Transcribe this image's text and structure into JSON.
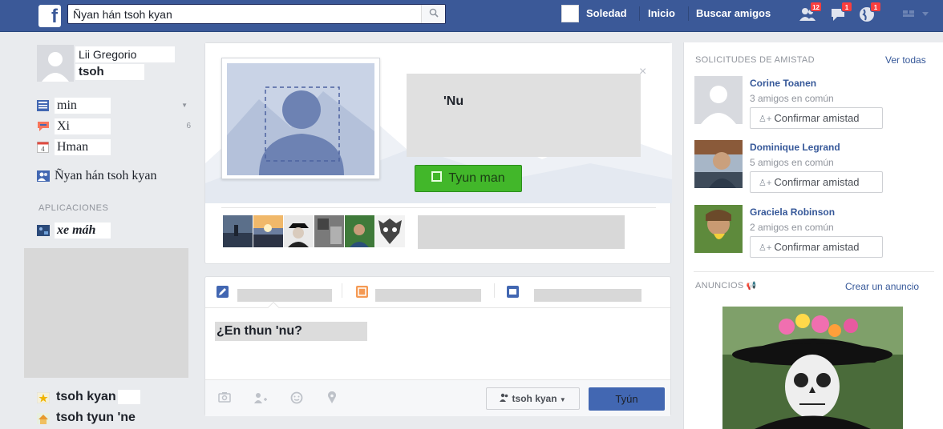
{
  "topbar": {
    "logo": "f",
    "search_value": "Ñyan hán tsoh kyan",
    "search_icon": "search-icon",
    "user_name": "Soledad",
    "home": "Inicio",
    "find_friends": "Buscar amigos",
    "friend_requests_badge": "12",
    "messages_badge": "1",
    "notifications_badge": "1"
  },
  "left": {
    "name_first": "Lii Gregorio",
    "name_second": "tsoh",
    "items": [
      {
        "label": "min",
        "icon": "news-feed-icon"
      },
      {
        "label": "Xi",
        "icon": "messages-icon",
        "count": "6"
      },
      {
        "label": "Hman",
        "icon": "events-icon",
        "date": "4"
      },
      {
        "label": "Ñyan hán tsoh kyan",
        "icon": "find-friends-icon"
      }
    ],
    "apps_label": "APLICACIONES",
    "app_item": "xe máh",
    "bottom_items": [
      {
        "label": "tsoh kyan",
        "icon": "star-icon"
      },
      {
        "label": "tsoh tyun 'ne",
        "icon": "house-icon"
      }
    ]
  },
  "hero": {
    "text": "'Nu",
    "button_label": "Tyun man",
    "close": "×"
  },
  "composer": {
    "placeholder": "¿En thun 'nu?",
    "audience": "tsoh kyan",
    "post_label": "Tyún"
  },
  "right": {
    "requests_header": "SOLICITUDES DE AMISTAD",
    "see_all": "Ver todas",
    "requests": [
      {
        "name": "Corine Toanen",
        "mutual": "3 amigos en común",
        "button": "Confirmar amistad"
      },
      {
        "name": "Dominique Legrand",
        "mutual": "5 amigos en común",
        "button": "Confirmar amistad"
      },
      {
        "name": "Graciela Robinson",
        "mutual": "2 amigos en común",
        "button": "Confirmar amistad"
      }
    ],
    "ads_header": "ANUNCIOS",
    "create_ad": "Crear un anuncio"
  }
}
